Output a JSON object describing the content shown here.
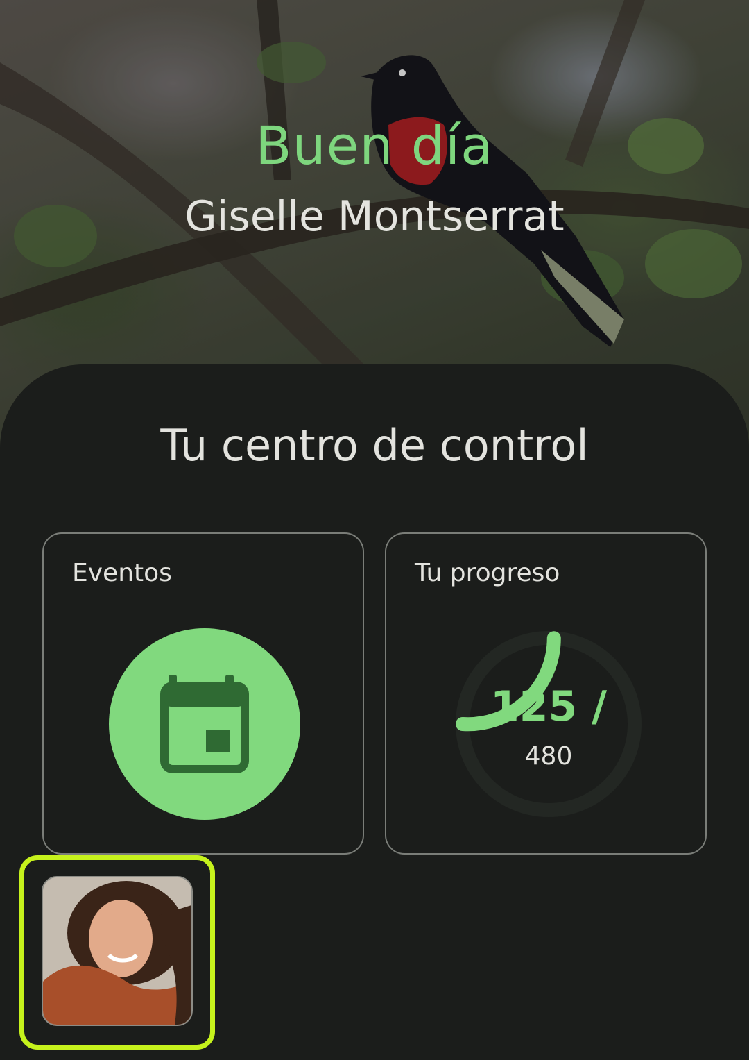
{
  "header": {
    "greeting": "Buen día",
    "user_name": "Giselle Montserrat"
  },
  "control_center": {
    "title": "Tu centro de control",
    "events_card": {
      "label": "Eventos",
      "icon": "calendar-icon"
    },
    "progress_card": {
      "label": "Tu progreso",
      "current": "125 /",
      "total": "480",
      "progress_fraction": 0.26
    }
  },
  "profile": {
    "avatar": "profile-photo"
  },
  "colors": {
    "accent_green": "#81d97e",
    "greeting_green": "#7ed67e",
    "background": "#1b1d1b",
    "highlight_border": "#c6f21c"
  }
}
